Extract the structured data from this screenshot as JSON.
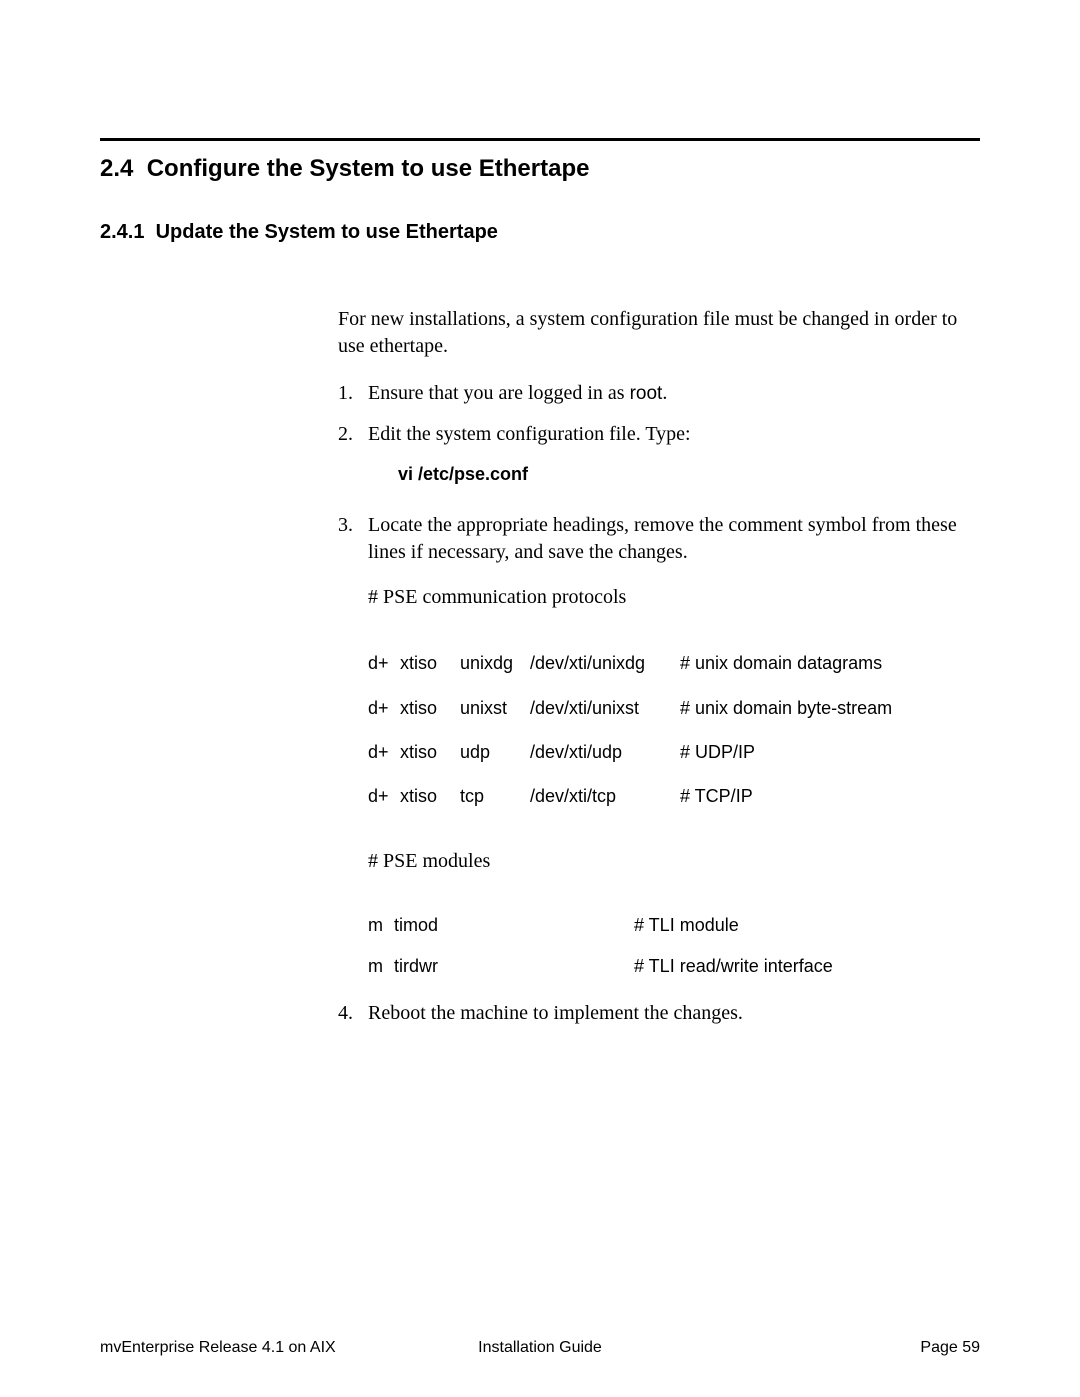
{
  "section": {
    "number": "2.4",
    "title": "Configure the System to use Ethertape"
  },
  "subsection": {
    "number": "2.4.1",
    "title": "Update the System to use Ethertape"
  },
  "intro": "For new installations, a system configuration file must be changed in order to use ethertape.",
  "steps": {
    "n1": "1.",
    "s1_pre": "Ensure that you are logged in as ",
    "s1_root": "root",
    "s1_post": ".",
    "n2": "2.",
    "s2": "Edit the system configuration file. Type:",
    "cmd": "vi /etc/pse.conf",
    "n3": "3.",
    "s3": "Locate the appropriate headings, remove the comment symbol from these lines if necessary, and save the changes.",
    "pse_protocols_label": "# PSE communication protocols",
    "protocols": [
      {
        "c1": "d+",
        "c2": "xtiso",
        "c3": "unixdg",
        "c4": "/dev/xti/unixdg",
        "c5": "# unix domain datagrams"
      },
      {
        "c1": "d+",
        "c2": "xtiso",
        "c3": "unixst",
        "c4": "/dev/xti/unixst",
        "c5": "# unix domain byte-stream"
      },
      {
        "c1": "d+",
        "c2": "xtiso",
        "c3": "udp",
        "c4": "/dev/xti/udp",
        "c5": "# UDP/IP"
      },
      {
        "c1": "d+",
        "c2": "xtiso",
        "c3": "tcp",
        "c4": "/dev/xti/tcp",
        "c5": "# TCP/IP"
      }
    ],
    "pse_modules_label": "# PSE modules",
    "modules": [
      {
        "c1": "m",
        "c2": "timod",
        "c3": "# TLI module"
      },
      {
        "c1": "m",
        "c2": "tirdwr",
        "c3": "# TLI read/write interface"
      }
    ],
    "n4": "4.",
    "s4": "Reboot the machine to implement the changes."
  },
  "footer": {
    "left": "mvEnterprise Release 4.1 on AIX",
    "center": "Installation Guide",
    "right": "Page  59"
  }
}
